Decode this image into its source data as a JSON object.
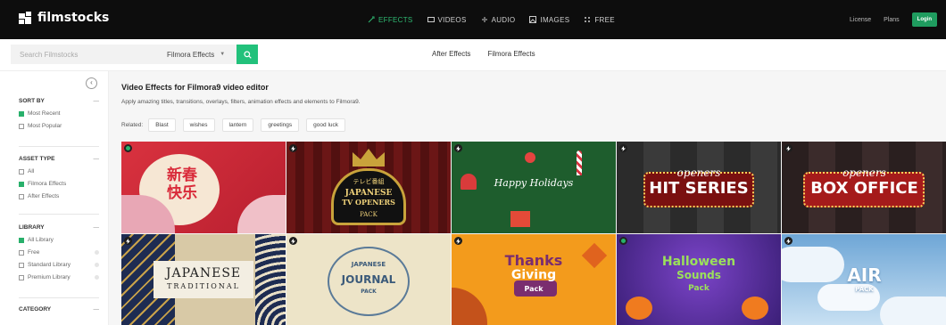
{
  "brand": {
    "name": "filmstocks"
  },
  "nav": [
    {
      "icon": "effects-icon",
      "label": "EFFECTS",
      "active": true
    },
    {
      "icon": "videos-icon",
      "label": "VIDEOS"
    },
    {
      "icon": "audio-icon",
      "label": "AUDIO"
    },
    {
      "icon": "images-icon",
      "label": "IMAGES"
    },
    {
      "icon": "free-icon",
      "label": "FREE"
    }
  ],
  "header_right": {
    "license": "License",
    "plans": "Plans",
    "login": "Login"
  },
  "search": {
    "placeholder": "Search Filmstocks",
    "dropdown": "Filmora Effects"
  },
  "subtabs": [
    "After Effects",
    "Filmora Effects"
  ],
  "sidebar": {
    "sort": {
      "title": "SORT BY",
      "options": [
        {
          "label": "Most Recent",
          "checked": true
        },
        {
          "label": "Most Popular",
          "checked": false
        }
      ]
    },
    "asset": {
      "title": "ASSET TYPE",
      "options": [
        {
          "label": "All",
          "checked": false
        },
        {
          "label": "Filmora Effects",
          "checked": true
        },
        {
          "label": "After Effects",
          "checked": false
        }
      ]
    },
    "library": {
      "title": "LIBRARY",
      "options": [
        {
          "label": "All Library",
          "checked": true
        },
        {
          "label": "Free",
          "checked": false
        },
        {
          "label": "Standard Library",
          "checked": false
        },
        {
          "label": "Premium Library",
          "checked": false
        }
      ]
    },
    "category": {
      "title": "CATEGORY"
    }
  },
  "main": {
    "title": "Video Effects for Filmora9 video editor",
    "description": "Apply amazing titles, transitions, overlays, filters, animation effects and elements to Filmora9.",
    "related_label": "Related:",
    "tags": [
      "Blast",
      "wishes",
      "lantern",
      "greetings",
      "good luck"
    ]
  },
  "tiles": [
    {
      "badge": "free",
      "lines": [
        "新春",
        "快乐"
      ],
      "bg": "#c8283a"
    },
    {
      "badge": "premium",
      "lines": [
        "テレビ番組",
        "JAPANESE",
        "TV OPENERS",
        "PACK"
      ],
      "bg": "#5a1212"
    },
    {
      "badge": "premium",
      "lines": [
        "Happy Holidays"
      ],
      "bg": "#1f5e2e"
    },
    {
      "badge": "premium",
      "lines": [
        "openers",
        "HIT SERIES"
      ],
      "bg": "#2a2a2a"
    },
    {
      "badge": "premium",
      "lines": [
        "openers",
        "BOX OFFICE"
      ],
      "bg": "#3a2020"
    },
    {
      "badge": "premium",
      "lines": [
        "JAPANESE",
        "TRADITIONAL"
      ],
      "bg": "#d9cba8"
    },
    {
      "badge": "premium",
      "lines": [
        "JAPANESE",
        "JOURNAL",
        "PACK"
      ],
      "bg": "#eee6cc"
    },
    {
      "badge": "premium",
      "lines": [
        "Thanks",
        "Giving",
        "Pack"
      ],
      "bg": "#f29a1b"
    },
    {
      "badge": "free",
      "lines": [
        "Halloween",
        "Sounds",
        "Pack"
      ],
      "bg": "#4b2a8c"
    },
    {
      "badge": "premium",
      "lines": [
        "AIR",
        "PACK"
      ],
      "bg": "#a9cfea"
    }
  ],
  "colors": {
    "accent": "#22c17b",
    "topbar": "#0d0d0d"
  }
}
